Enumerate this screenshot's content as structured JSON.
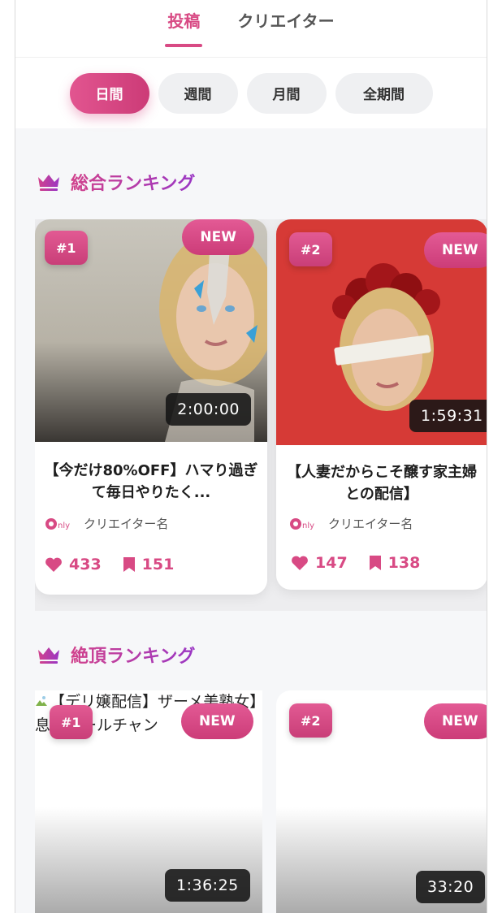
{
  "tabs": [
    {
      "label": "投稿",
      "active": true
    },
    {
      "label": "クリエイター",
      "active": false
    }
  ],
  "periods": [
    {
      "label": "日間",
      "active": true
    },
    {
      "label": "週間",
      "active": false
    },
    {
      "label": "月間",
      "active": false
    },
    {
      "label": "全期間",
      "active": false
    }
  ],
  "sections": [
    {
      "title": "総合ランキング",
      "icon": "crown-icon",
      "cards": [
        {
          "rank": "#1",
          "badge": "NEW",
          "duration": "2:00:00",
          "title": "【今だけ80%OFF】ハマり過ぎて毎日やりたく...",
          "creator": "クリエイター名",
          "likes": "433",
          "bookmarks": "151"
        },
        {
          "rank": "#2",
          "badge": "NEW",
          "duration": "1:59:31",
          "title": "【人妻だからこそ醸す家主婦との配信】",
          "creator": "クリエイター名",
          "likes": "147",
          "bookmarks": "138"
        }
      ]
    },
    {
      "title": "絶頂ランキング",
      "icon": "crown-icon",
      "cards": [
        {
          "rank": "#1",
          "badge": "NEW",
          "duration": "1:36:25",
          "alt_text": "【デリ嬢配信】ザーメ美熟女】息子マールチャン"
        },
        {
          "rank": "#2",
          "badge": "NEW",
          "duration": "33:20"
        }
      ]
    }
  ],
  "colors": {
    "accent": "#d84a84",
    "purple": "#9a36c4",
    "background": "#f6f7f9"
  }
}
